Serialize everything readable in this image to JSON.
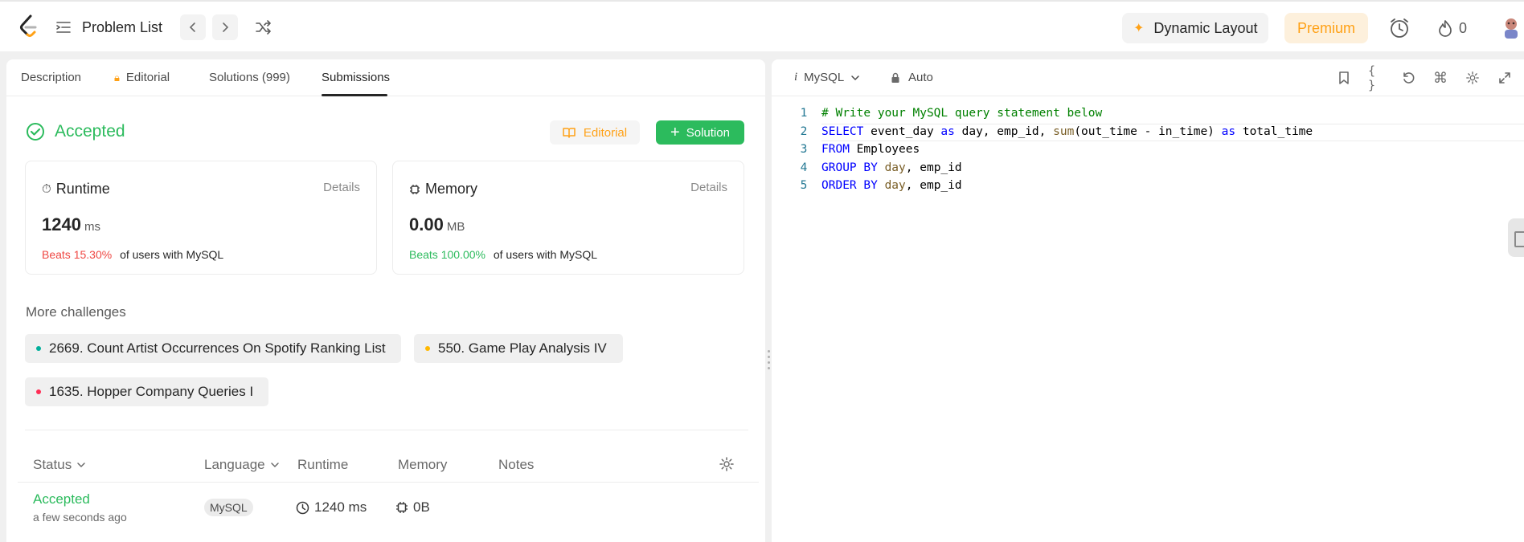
{
  "topbar": {
    "problem_list": "Problem List",
    "dynamic_layout": "Dynamic Layout",
    "premium": "Premium",
    "streak": "0",
    "icons": [
      "logo-icon",
      "list-icon",
      "chevron-left-icon",
      "chevron-right-icon",
      "shuffle-icon",
      "sparkle-icon",
      "alarm-icon",
      "fire-icon",
      "avatar"
    ],
    "accent_color": "#ffa116"
  },
  "tabs": [
    {
      "label": "Description"
    },
    {
      "label": "Editorial"
    },
    {
      "label": "Solutions (999)"
    },
    {
      "label": "Submissions"
    }
  ],
  "result": {
    "status": "Accepted",
    "status_color": "#2cbb5d",
    "editorial_btn": "Editorial",
    "solution_btn": "Solution"
  },
  "runtime": {
    "title": "Runtime",
    "details": "Details",
    "value": "1240",
    "unit": "ms",
    "beats_pct": "Beats 15.30%",
    "beats_text": "of users with MySQL"
  },
  "memory": {
    "title": "Memory",
    "details": "Details",
    "value": "0.00",
    "unit": "MB",
    "beats_pct": "Beats 100.00%",
    "beats_text": "of users with MySQL"
  },
  "more": {
    "title": "More challenges",
    "items": [
      {
        "label": "2669. Count Artist Occurrences On Spotify Ranking List",
        "color": "#00af9b"
      },
      {
        "label": "550. Game Play Analysis IV",
        "color": "#ffb800"
      },
      {
        "label": "1635. Hopper Company Queries I",
        "color": "#ff2d55"
      }
    ]
  },
  "table": {
    "headers": {
      "status": "Status",
      "language": "Language",
      "runtime": "Runtime",
      "memory": "Memory",
      "notes": "Notes"
    },
    "rows": [
      {
        "status": "Accepted",
        "time": "a few seconds ago",
        "language": "MySQL",
        "runtime": "1240 ms",
        "memory": "0B"
      }
    ]
  },
  "editor": {
    "language": "MySQL",
    "mode": "Auto",
    "lines": [
      {
        "num": "1",
        "tokens": [
          {
            "t": "# Write your MySQL query statement below",
            "c": "comment"
          }
        ]
      },
      {
        "num": "2",
        "tokens": [
          {
            "t": "SELECT",
            "c": "kw"
          },
          {
            "t": " event_day ",
            "c": ""
          },
          {
            "t": "as",
            "c": "kw"
          },
          {
            "t": " day, emp_id, ",
            "c": ""
          },
          {
            "t": "sum",
            "c": "fn"
          },
          {
            "t": "(out_time - in_time) ",
            "c": ""
          },
          {
            "t": "as",
            "c": "kw"
          },
          {
            "t": " total_time",
            "c": ""
          }
        ]
      },
      {
        "num": "3",
        "tokens": [
          {
            "t": "FROM",
            "c": "kw"
          },
          {
            "t": " Employees",
            "c": ""
          }
        ]
      },
      {
        "num": "4",
        "tokens": [
          {
            "t": "GROUP BY",
            "c": "kw"
          },
          {
            "t": " ",
            "c": ""
          },
          {
            "t": "day",
            "c": "fn"
          },
          {
            "t": ", emp_id",
            "c": ""
          }
        ]
      },
      {
        "num": "5",
        "tokens": [
          {
            "t": "ORDER BY",
            "c": "kw"
          },
          {
            "t": " ",
            "c": ""
          },
          {
            "t": "day",
            "c": "fn"
          },
          {
            "t": ", emp_id",
            "c": ""
          }
        ]
      }
    ]
  }
}
